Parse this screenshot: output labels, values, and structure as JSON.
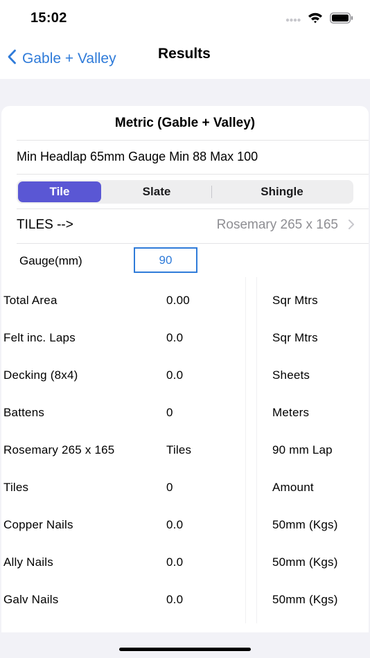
{
  "status_bar": {
    "time": "15:02"
  },
  "nav": {
    "back_label": "Gable + Valley",
    "title": "Results"
  },
  "card": {
    "title": "Metric (Gable + Valley)",
    "info": "Min Headlap 65mm Gauge Min 88 Max 100",
    "segments": [
      {
        "label": "Tile",
        "selected": true
      },
      {
        "label": "Slate",
        "selected": false
      },
      {
        "label": "Shingle",
        "selected": false
      }
    ],
    "tiles_label": "TILES -->",
    "tiles_value": "Rosemary 265 x 165",
    "gauge_label": "Gauge(mm)",
    "gauge_value": "90"
  },
  "results": [
    {
      "label": "Total Area",
      "value": "0.00",
      "unit": "Sqr Mtrs"
    },
    {
      "label": "Felt inc. Laps",
      "value": "0.0",
      "unit": "Sqr Mtrs"
    },
    {
      "label": "Decking (8x4)",
      "value": "0.0",
      "unit": "Sheets"
    },
    {
      "label": "Battens",
      "value": "0",
      "unit": "Meters"
    },
    {
      "label": "Rosemary 265 x 165",
      "value": "Tiles",
      "unit": "90 mm Lap"
    },
    {
      "label": "Tiles",
      "value": "0",
      "unit": "Amount"
    },
    {
      "label": "Copper Nails",
      "value": "0.0",
      "unit": "50mm (Kgs)"
    },
    {
      "label": "Ally Nails",
      "value": "0.0",
      "unit": "50mm (Kgs)"
    },
    {
      "label": "Galv Nails",
      "value": "0.0",
      "unit": "50mm (Kgs)"
    }
  ],
  "colors": {
    "accent": "#2f7bd9",
    "segment_selected": "#5a57d4",
    "background": "#f2f2f7"
  }
}
